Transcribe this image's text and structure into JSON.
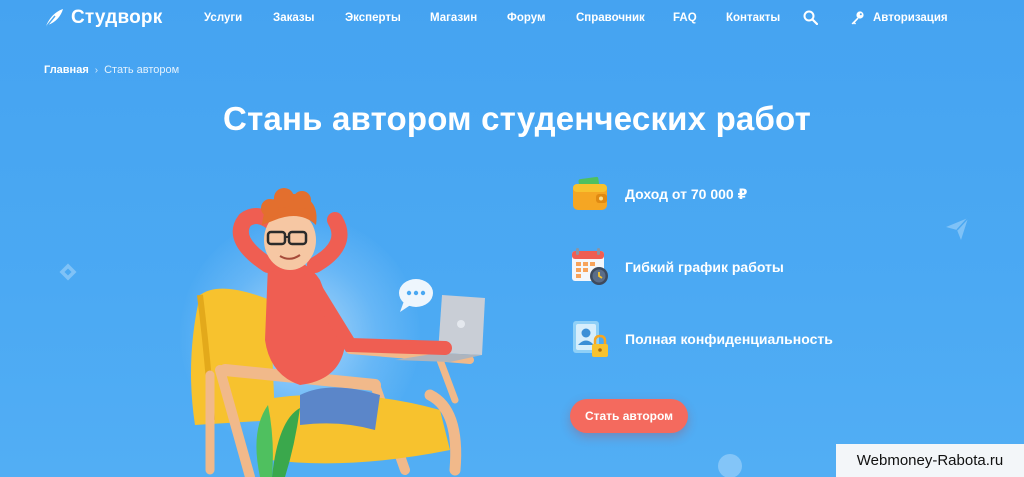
{
  "brand": {
    "name": "Студворк",
    "icon": "feather-icon"
  },
  "nav": {
    "items": [
      {
        "label": "Услуги"
      },
      {
        "label": "Заказы"
      },
      {
        "label": "Эксперты"
      },
      {
        "label": "Магазин"
      },
      {
        "label": "Форум"
      },
      {
        "label": "Справочник"
      },
      {
        "label": "FAQ"
      },
      {
        "label": "Контакты"
      }
    ],
    "search_icon": "search-icon",
    "auth_icon": "key-icon",
    "auth_label": "Авторизация"
  },
  "breadcrumb": {
    "home": "Главная",
    "separator": "›",
    "current": "Стать автором"
  },
  "hero": {
    "title": "Стань автором студенческих работ",
    "features": [
      {
        "icon": "wallet-icon",
        "label": "Доход от 70 000 ₽"
      },
      {
        "icon": "calendar-clock-icon",
        "label": "Гибкий график работы"
      },
      {
        "icon": "locked-profile-icon",
        "label": "Полная конфиденциальность"
      }
    ],
    "cta_label": "Стать автором"
  },
  "watermark": "Webmoney-Rabota.ru",
  "colors": {
    "background": "#4aa8f2",
    "cta": "#f46a5e",
    "text": "#ffffff"
  }
}
